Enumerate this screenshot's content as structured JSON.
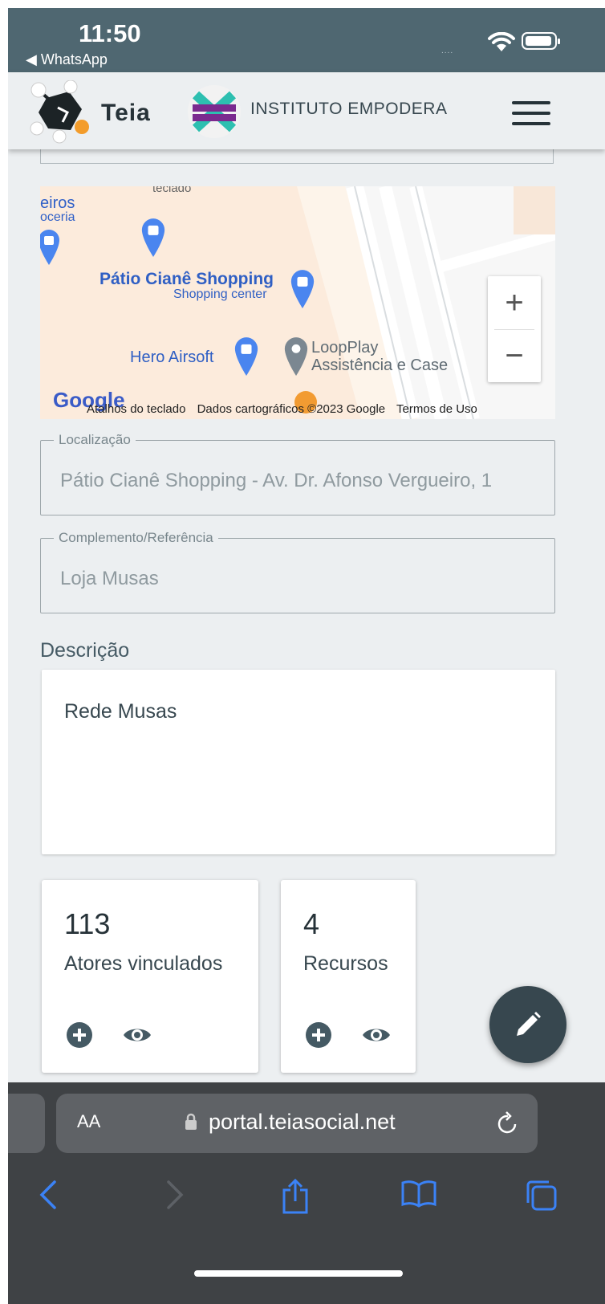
{
  "status_bar": {
    "time": "11:50",
    "back_app": "◀ WhatsApp",
    "signal": "....",
    "wifi_icon": "wifi-icon",
    "battery_icon": "battery-icon"
  },
  "header": {
    "app_name": "Teia",
    "org_name": "INSTITUTO EMPODERA",
    "menu_icon": "hamburger-menu-icon"
  },
  "map": {
    "labels": {
      "partial_top": "teclado",
      "partial_left_1": "eiros",
      "partial_left_2": "oceria",
      "shopping_name": "Pátio Cianê Shopping",
      "shopping_type": "Shopping center",
      "hero": "Hero Airsoft",
      "loop_1": "LoopPlay",
      "loop_2": "Assistência e Case"
    },
    "google_logo": "Google",
    "credits": {
      "shortcuts": "Atalhos do teclado",
      "data": "Dados cartográficos ©2023 Google",
      "terms": "Termos de Uso"
    },
    "zoom_in": "+",
    "zoom_out": "−"
  },
  "form": {
    "location": {
      "label": "Localização",
      "value": "Pátio Cianê Shopping - Av. Dr. Afonso Vergueiro, 1"
    },
    "complement": {
      "label": "Complemento/Referência",
      "value": "Loja Musas"
    },
    "description": {
      "label": "Descrição",
      "value": "Rede Musas"
    }
  },
  "cards": [
    {
      "count": "113",
      "label": "Atores vinculados"
    },
    {
      "count": "4",
      "label": "Recursos"
    }
  ],
  "fab_icon": "pencil-edit-icon",
  "browser": {
    "aa": "AA",
    "url": "portal.teiasocial.net"
  },
  "colors": {
    "status_bar": "#4f6771",
    "background": "#eceff1",
    "fab": "#37474f",
    "browser_bar": "#3f4245",
    "ios_blue": "#3b82f6"
  }
}
